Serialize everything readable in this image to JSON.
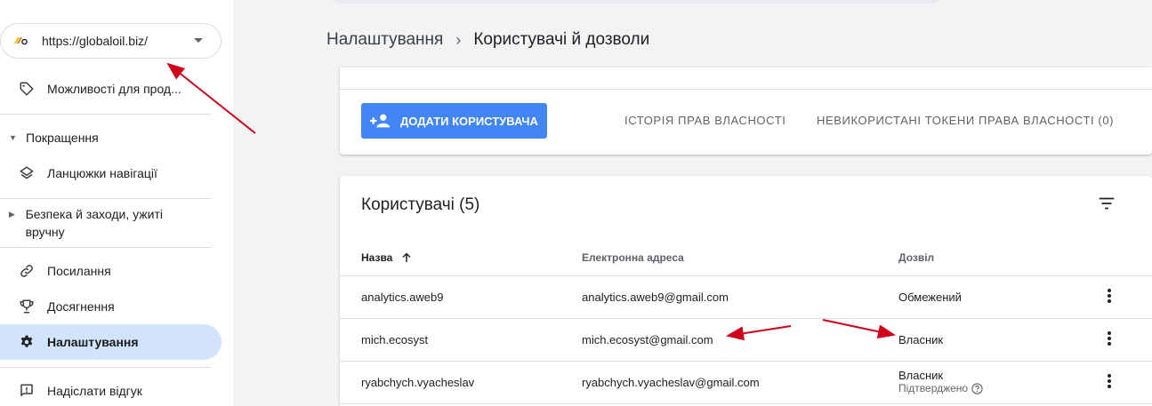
{
  "property": {
    "url": "https://globaloil.biz/",
    "logo_icon": "property-favicon"
  },
  "sidebar": {
    "items": [
      {
        "label": "Можливості для прод...",
        "icon": "tag-icon"
      },
      {
        "label": "Покращення",
        "type": "group",
        "expanded": true
      },
      {
        "label": "Ланцюжки навігації",
        "icon": "layers-icon"
      },
      {
        "label": "Безпека й заходи, ужиті вручну",
        "type": "group",
        "expanded": false
      },
      {
        "label": "Посилання",
        "icon": "link-icon"
      },
      {
        "label": "Досягнення",
        "icon": "trophy-icon"
      },
      {
        "label": "Налаштування",
        "icon": "gear-icon",
        "active": true
      },
      {
        "label": "Надіслати відгук",
        "icon": "feedback-icon"
      }
    ]
  },
  "breadcrumb": {
    "parent": "Налаштування",
    "current": "Користувачі й дозволи"
  },
  "actions": {
    "add_user": "ДОДАТИ КОРИСТУВАЧА",
    "ownership_history": "ІСТОРІЯ ПРАВ ВЛАСНОСТІ",
    "unused_tokens": "НЕВИКОРИСТАНІ ТОКЕНИ ПРАВА ВЛАСНОСТІ (0)"
  },
  "users": {
    "title": "Користувачі (5)",
    "columns": {
      "name": "Назва",
      "email": "Електронна адреса",
      "permission": "Дозвіл"
    },
    "rows": [
      {
        "name": "analytics.aweb9",
        "email": "analytics.aweb9@gmail.com",
        "permission": "Обмежений",
        "sub": ""
      },
      {
        "name": "mich.ecosyst",
        "email": "mich.ecosyst@gmail.com",
        "permission": "Власник",
        "sub": ""
      },
      {
        "name": "ryabchych.vyacheslav",
        "email": "ryabchych.vyacheslav@gmail.com",
        "permission": "Власник",
        "sub": "Підтверджено"
      }
    ]
  },
  "colors": {
    "accent": "#4285f4",
    "active_nav": "#d2e3fc",
    "annotation_arrow": "#d0021b"
  }
}
